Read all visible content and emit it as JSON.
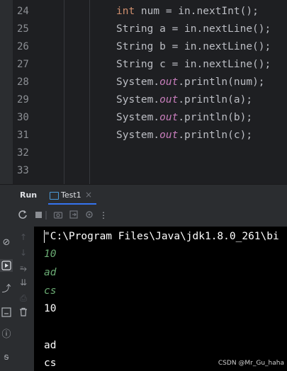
{
  "editor": {
    "lines": [
      {
        "number": "24",
        "pre": "",
        "keyword": "int",
        "text": " num = in.nextInt();",
        "field": "",
        "post": ""
      },
      {
        "number": "25",
        "pre": "String a = in.nextLine();",
        "keyword": "",
        "text": "",
        "field": "",
        "post": ""
      },
      {
        "number": "26",
        "pre": "String b = in.nextLine();",
        "keyword": "",
        "text": "",
        "field": "",
        "post": ""
      },
      {
        "number": "27",
        "pre": "String c = in.nextLine();",
        "keyword": "",
        "text": "",
        "field": "",
        "post": ""
      },
      {
        "number": "28",
        "pre": "System.",
        "keyword": "",
        "text": "",
        "field": "out",
        "post": ".println(num);"
      },
      {
        "number": "29",
        "pre": "System.",
        "keyword": "",
        "text": "",
        "field": "out",
        "post": ".println(a);"
      },
      {
        "number": "30",
        "pre": "System.",
        "keyword": "",
        "text": "",
        "field": "out",
        "post": ".println(b);"
      },
      {
        "number": "31",
        "pre": "System.",
        "keyword": "",
        "text": "",
        "field": "out",
        "post": ".println(c);"
      },
      {
        "number": "32",
        "pre": "",
        "keyword": "",
        "text": "",
        "field": "",
        "post": ""
      },
      {
        "number": "33",
        "pre": "",
        "keyword": "",
        "text": "",
        "field": "",
        "post": ""
      }
    ]
  },
  "run_window": {
    "title": "Run",
    "tab_label": "Test1",
    "tab_close": "×"
  },
  "console": {
    "command": "\"C:\\Program Files\\Java\\jdk1.8.0_261\\bi",
    "lines": [
      {
        "text": "10",
        "kind": "input"
      },
      {
        "text": "ad",
        "kind": "input"
      },
      {
        "text": "cs",
        "kind": "input"
      },
      {
        "text": "10",
        "kind": "output"
      },
      {
        "text": "",
        "kind": "output"
      },
      {
        "text": "ad",
        "kind": "output"
      },
      {
        "text": "cs",
        "kind": "output"
      }
    ]
  },
  "icons": {
    "toolbar": [
      "rerun-icon",
      "stop-icon",
      "camera-icon",
      "exit-icon",
      "settings-icon",
      "more-icon"
    ],
    "left_bar": [
      "commit-icon",
      "run-icon",
      "vcs-icon",
      "terminal-icon",
      "problems-icon",
      "git-icon"
    ],
    "console_tools": [
      "up-arrow-icon",
      "down-arrow-icon",
      "soft-wrap-icon",
      "scroll-to-end-icon",
      "print-icon",
      "trash-icon"
    ]
  },
  "colors": {
    "keyword": "#cf8e6d",
    "field": "#c77dbb",
    "user_input": "#6aab73",
    "accent": "#3574f0"
  },
  "watermark": "CSDN @Mr_Gu_haha"
}
